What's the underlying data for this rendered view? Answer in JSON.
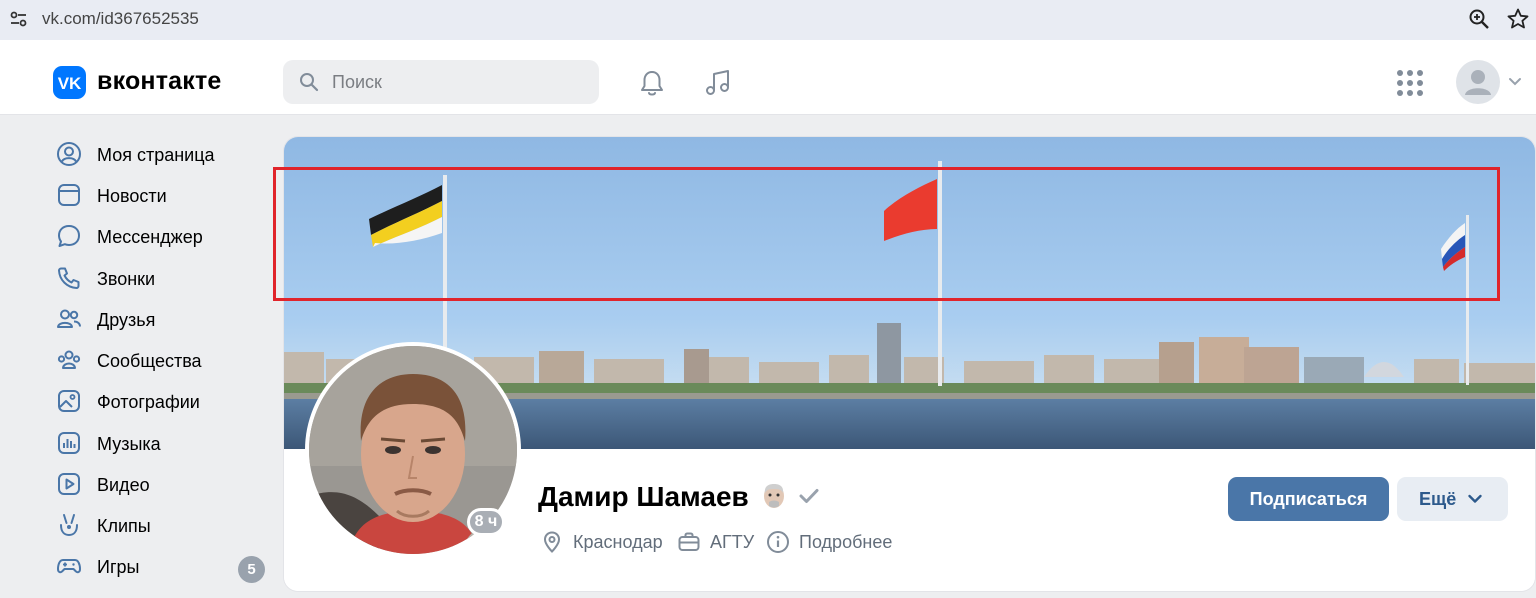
{
  "browser": {
    "url": "vk.com/id367652535",
    "icons": [
      "site-settings-icon",
      "zoom-icon",
      "star-icon"
    ]
  },
  "header": {
    "logo_text": "вконтакте",
    "search_placeholder": "Поиск",
    "icons": [
      "search-icon",
      "bell-icon",
      "music-icon",
      "apps-icon",
      "avatar",
      "chevron-down-icon"
    ]
  },
  "sidebar": {
    "items": [
      {
        "label": "Моя страница",
        "icon": "user-circle-icon"
      },
      {
        "label": "Новости",
        "icon": "news-icon"
      },
      {
        "label": "Мессенджер",
        "icon": "message-icon"
      },
      {
        "label": "Звонки",
        "icon": "phone-icon"
      },
      {
        "label": "Друзья",
        "icon": "friends-icon"
      },
      {
        "label": "Сообщества",
        "icon": "communities-icon"
      },
      {
        "label": "Фотографии",
        "icon": "photo-icon"
      },
      {
        "label": "Музыка",
        "icon": "music-icon"
      },
      {
        "label": "Видео",
        "icon": "video-icon"
      },
      {
        "label": "Клипы",
        "icon": "clips-icon"
      },
      {
        "label": "Игры",
        "icon": "games-icon",
        "badge": "5"
      }
    ]
  },
  "profile": {
    "name": "Дамир Шамаев",
    "online": "8 ч",
    "city": "Краснодар",
    "university": "АГТУ",
    "details": "Подробнее",
    "subscribe_label": "Подписаться",
    "more_label": "Ещё"
  },
  "colors": {
    "vk_blue": "#0077ff",
    "button_blue": "#4a76a8",
    "highlight_red": "#e0242b",
    "sky": "#9cc3e8",
    "water": "#4f6f92"
  }
}
